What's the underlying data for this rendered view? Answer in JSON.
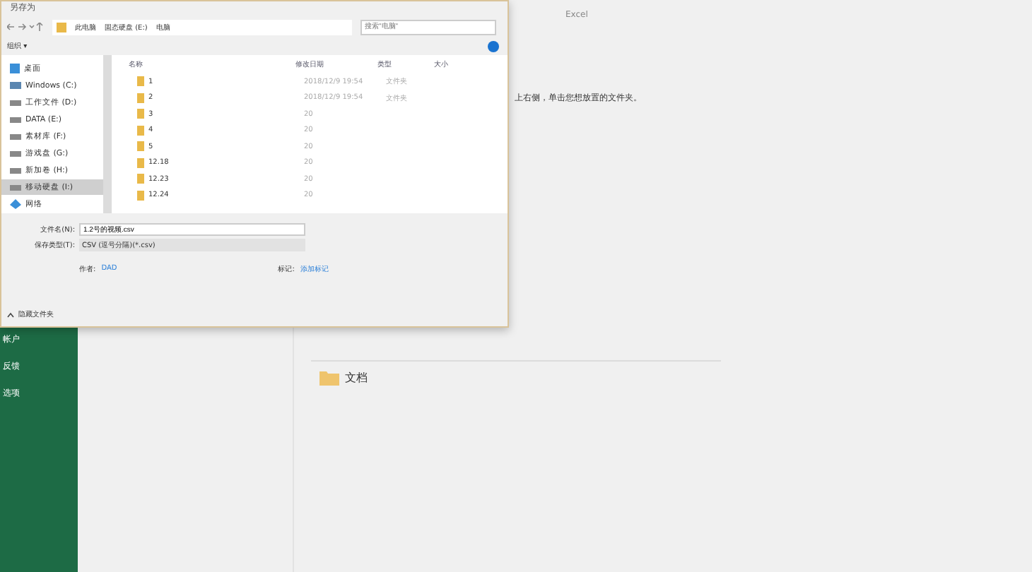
{
  "app": {
    "title": "Excel",
    "hint": "上右侧，单击您想放置的文件夹。",
    "nav": [
      {
        "label": "帐户"
      },
      {
        "label": "反馈"
      },
      {
        "label": "选项"
      }
    ],
    "folders": [
      {
        "name": "文档"
      }
    ]
  },
  "dialog": {
    "title": "另存为",
    "breadcrumb": [
      "此电脑",
      "固态硬盘 (E:)",
      "电脑"
    ],
    "search": {
      "placeholder": "搜索\"电脑\""
    },
    "organize": "组织 ▾",
    "sidebar": {
      "items": [
        {
          "label": "桌面",
          "kind": "desktop",
          "selected": false
        },
        {
          "label": "Windows (C:)",
          "kind": "system",
          "selected": false
        },
        {
          "label": "工作文件 (D:)",
          "kind": "drive",
          "selected": false
        },
        {
          "label": "DATA (E:)",
          "kind": "drive",
          "selected": false
        },
        {
          "label": "素材库 (F:)",
          "kind": "drive",
          "selected": false
        },
        {
          "label": "游戏盘 (G:)",
          "kind": "drive",
          "selected": false
        },
        {
          "label": "新加卷 (H:)",
          "kind": "drive",
          "selected": false
        },
        {
          "label": "移动硬盘 (I:)",
          "kind": "drive",
          "selected": true
        },
        {
          "label": "网络",
          "kind": "network",
          "selected": false
        }
      ]
    },
    "table": {
      "columns": [
        "名称",
        "修改日期",
        "类型",
        "大小"
      ],
      "rows": [
        {
          "name": "1",
          "date": "2018/12/9 19:54",
          "type": "文件夹"
        },
        {
          "name": "2",
          "date": "2018/12/9 19:54",
          "type": "文件夹"
        },
        {
          "name": "3",
          "date": "20"
        },
        {
          "name": "4",
          "date": "20"
        },
        {
          "name": "5",
          "date": "20"
        },
        {
          "name": "12.18",
          "date": "20"
        },
        {
          "name": "12.23",
          "date": "20"
        },
        {
          "name": "12.24",
          "date": "20"
        }
      ]
    },
    "filename": {
      "label": "文件名(N):",
      "value": "1.2号的视频.csv"
    },
    "filetype": {
      "label": "保存类型(T):",
      "value": "CSV (逗号分隔)(*.csv)"
    },
    "author": {
      "label": "作者:",
      "value": "DAD"
    },
    "tags": {
      "label": "标记:",
      "value": "添加标记"
    },
    "hide_folders": "隐藏文件夹"
  }
}
